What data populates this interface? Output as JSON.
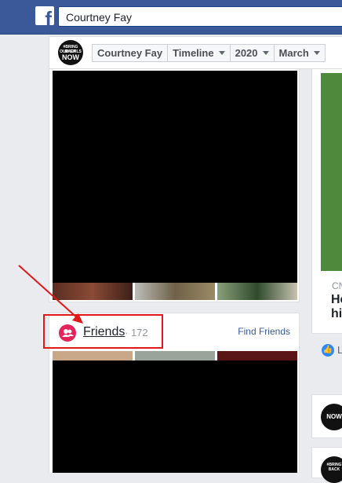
{
  "header": {
    "logo_letter": "f",
    "search_value": "Courtney Fay"
  },
  "timeline_nav": {
    "avatar_text": [
      "#BRING BACK",
      "OUR GIRLS",
      "NOW"
    ],
    "crumbs": [
      {
        "label": "Courtney Fay",
        "dropdown": false
      },
      {
        "label": "Timeline",
        "dropdown": true
      },
      {
        "label": "2020",
        "dropdown": true
      },
      {
        "label": "March",
        "dropdown": true
      }
    ]
  },
  "friends": {
    "title": "Friends",
    "count": "· 172",
    "find_link": "Find Friends"
  },
  "right_column": {
    "source": "CN",
    "headline_lines": [
      "He",
      "hi"
    ],
    "like_text": "L"
  },
  "colors": {
    "topbar": "#3b5998",
    "friends_icon": "#e4235b",
    "annotation": "#e01818",
    "link": "#365899"
  }
}
